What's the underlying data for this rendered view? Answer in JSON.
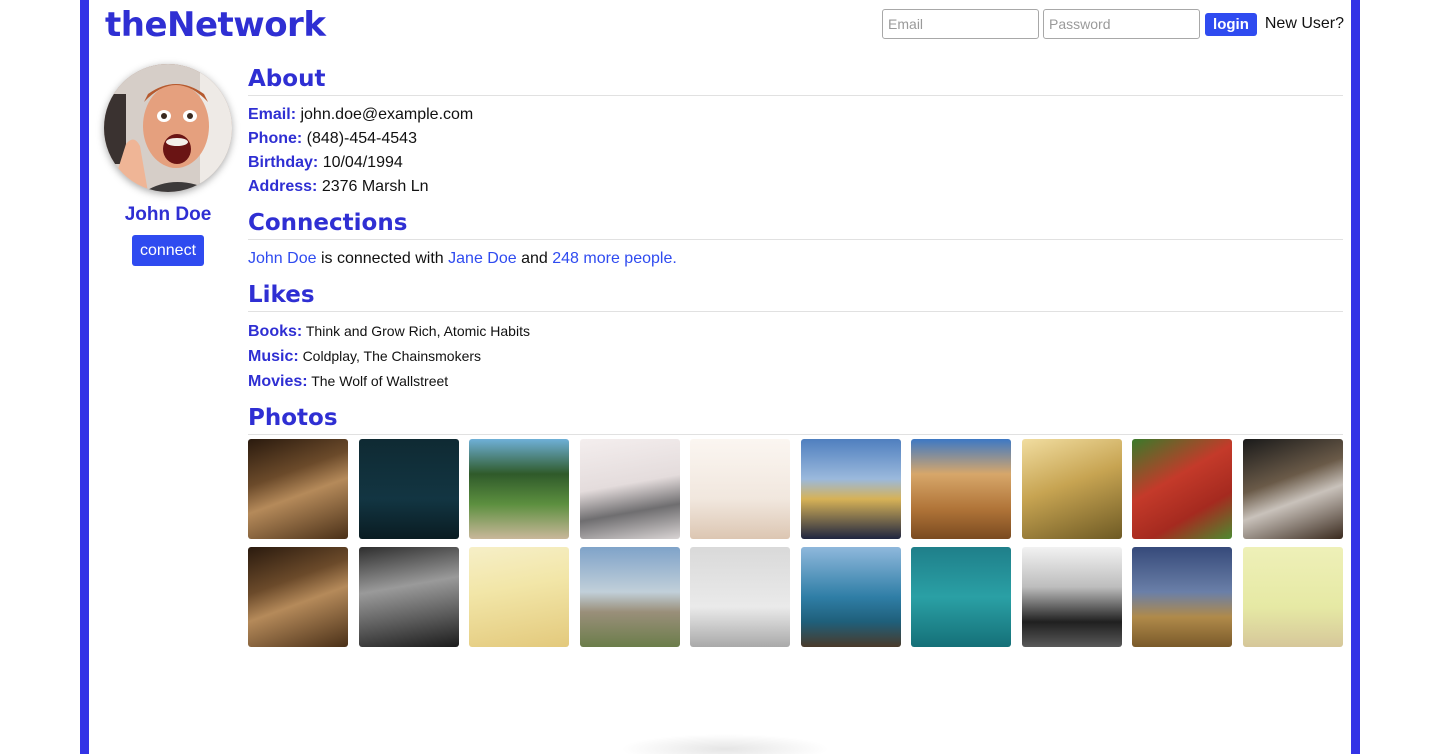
{
  "brand": "theNetwork",
  "login": {
    "email_placeholder": "Email",
    "password_placeholder": "Password",
    "login_label": "login",
    "new_user": "New User?"
  },
  "profile": {
    "name": "John Doe",
    "connect_label": "connect"
  },
  "about": {
    "title": "About",
    "fields": [
      {
        "label": "Email:",
        "value": "john.doe@example.com"
      },
      {
        "label": "Phone:",
        "value": "(848)-454-4543"
      },
      {
        "label": "Birthday:",
        "value": "10/04/1994"
      },
      {
        "label": "Address:",
        "value": "2376 Marsh Ln"
      }
    ]
  },
  "connections": {
    "title": "Connections",
    "person": "John Doe",
    "middle": "is connected with",
    "friend": "Jane Doe",
    "and": "and",
    "more": "248 more people."
  },
  "likes": {
    "title": "Likes",
    "items": [
      {
        "label": "Books:",
        "value": "Think and Grow Rich, Atomic Habits"
      },
      {
        "label": "Music:",
        "value": "Coldplay, The Chainsmokers"
      },
      {
        "label": "Movies:",
        "value": "The Wolf of Wallstreet"
      }
    ]
  },
  "photos": {
    "title": "Photos",
    "items": [
      {
        "name": "photo-shells-on-wood",
        "bg": "linear-gradient(160deg,#2a1a0e 0%,#6b4a2a 35%,#b58a5a 55%,#4a3018 100%)"
      },
      {
        "name": "photo-night-city",
        "bg": "linear-gradient(180deg,#0f2a33 0%,#123542 60%,#0a1c22 100%)"
      },
      {
        "name": "photo-forest-path",
        "bg": "linear-gradient(180deg,#6fb0d8 0%,#2f5a2a 35%,#5c8f3f 65%,#c9b79a 100%)"
      },
      {
        "name": "photo-record-player",
        "bg": "linear-gradient(170deg,#f4eeee 0%,#e4dcdc 45%,#6f6e70 70%,#d9d4d4 100%)"
      },
      {
        "name": "photo-palm-trees",
        "bg": "linear-gradient(180deg,#fbf6f1 0%,#f1e7de 60%,#dcc6b2 100%)"
      },
      {
        "name": "photo-legs-in-field",
        "bg": "linear-gradient(180deg,#4f7fbf 0%,#9bb9dc 40%,#d7b257 60%,#1f2540 100%)"
      },
      {
        "name": "photo-beach-shells",
        "bg": "linear-gradient(180deg,#3d78c4 0%,#d7a76a 35%,#b07438 70%,#7a4a20 100%)"
      },
      {
        "name": "photo-sunlit-grass",
        "bg": "linear-gradient(160deg,#f1dda0 0%,#c7a452 45%,#6e5a24 100%)"
      },
      {
        "name": "photo-red-door",
        "bg": "linear-gradient(150deg,#3a7a2a 0%,#c43a2a 40%,#a52a1f 70%,#4e8a30 100%)"
      },
      {
        "name": "photo-laptop-phone",
        "bg": "linear-gradient(160deg,#1a1a1a 0%,#6a5a48 40%,#c9c2bb 60%,#3a2a1e 100%)"
      },
      {
        "name": "photo-shells-on-wood-2",
        "bg": "linear-gradient(160deg,#2a1a0e 0%,#6b4a2a 35%,#b58a5a 55%,#4a3018 100%)"
      },
      {
        "name": "photo-grass-bw",
        "bg": "linear-gradient(170deg,#2e2e2e 0%,#9a9a9a 40%,#5c5c5c 70%,#1c1c1c 100%)"
      },
      {
        "name": "photo-dreamcatcher",
        "bg": "linear-gradient(170deg,#f6efc7 0%,#f2e6a8 40%,#e3c97c 100%)"
      },
      {
        "name": "photo-castle",
        "bg": "linear-gradient(180deg,#7fa3c9 0%,#c1cfd9 45%,#9a8f7a 65%,#6b7d4a 100%)"
      },
      {
        "name": "photo-seagull-sea",
        "bg": "linear-gradient(180deg,#d9d9d9 0%,#eaeaea 60%,#a9a9a9 100%)"
      },
      {
        "name": "photo-rocky-shore",
        "bg": "linear-gradient(180deg,#8fb8dc 0%,#2f7ea6 50%,#1f5f7a 75%,#4a3a2a 100%)"
      },
      {
        "name": "photo-boat-lagoon",
        "bg": "linear-gradient(180deg,#1f7f8a 0%,#2aa0a5 50%,#157078 100%)"
      },
      {
        "name": "photo-feet-bw",
        "bg": "linear-gradient(180deg,#f2f2f2 0%,#bdbdbd 40%,#202020 75%,#595959 100%)"
      },
      {
        "name": "photo-hills-dusk",
        "bg": "linear-gradient(180deg,#364a7a 0%,#6a7fa8 45%,#b08a4a 70%,#7a5a2a 100%)"
      },
      {
        "name": "photo-pale-sea",
        "bg": "linear-gradient(180deg,#eef0b8 0%,#e6e9a4 60%,#d6c79a 100%)"
      }
    ]
  }
}
